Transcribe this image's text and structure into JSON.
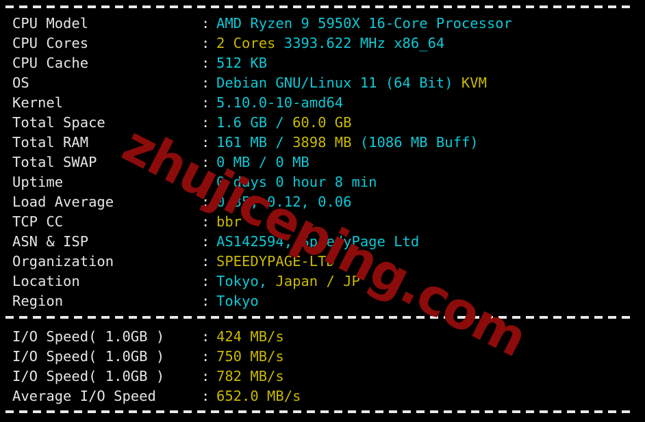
{
  "terminal": {
    "background_color": "#000000",
    "label_color": "#e6e6e6",
    "cyan_color": "#0fc7d4",
    "yellow_color": "#c9b900",
    "separator_char": "-",
    "colon": ":"
  },
  "watermark": {
    "text": "zhujiceping.com",
    "color": "#8c0b0b"
  },
  "system_info": {
    "rows": [
      {
        "label": "CPU Model",
        "segments": [
          {
            "text": "AMD Ryzen 9 5950X 16-Core Processor",
            "color": "cyan"
          }
        ]
      },
      {
        "label": "CPU Cores",
        "segments": [
          {
            "text": "2 Cores ",
            "color": "yellow"
          },
          {
            "text": "3393.622 MHz x86_64",
            "color": "cyan"
          }
        ]
      },
      {
        "label": "CPU Cache",
        "segments": [
          {
            "text": "512 KB",
            "color": "cyan"
          }
        ]
      },
      {
        "label": "OS",
        "segments": [
          {
            "text": "Debian GNU/Linux 11 (64 Bit) ",
            "color": "cyan"
          },
          {
            "text": "KVM",
            "color": "yellow"
          }
        ]
      },
      {
        "label": "Kernel",
        "segments": [
          {
            "text": "5.10.0-10-amd64",
            "color": "cyan"
          }
        ]
      },
      {
        "label": "Total Space",
        "segments": [
          {
            "text": "1.6 GB ",
            "color": "cyan"
          },
          {
            "text": "/ ",
            "color": "cyan"
          },
          {
            "text": "60.0 GB",
            "color": "yellow"
          }
        ]
      },
      {
        "label": "Total RAM",
        "segments": [
          {
            "text": "161 MB / ",
            "color": "cyan"
          },
          {
            "text": "3898 MB ",
            "color": "yellow"
          },
          {
            "text": "(1086 MB Buff)",
            "color": "cyan"
          }
        ]
      },
      {
        "label": "Total SWAP",
        "segments": [
          {
            "text": "0 MB / 0 MB",
            "color": "cyan"
          }
        ]
      },
      {
        "label": "Uptime",
        "segments": [
          {
            "text": "0 days 0 hour 8 min",
            "color": "cyan"
          }
        ]
      },
      {
        "label": "Load Average",
        "segments": [
          {
            "text": "0.35, 0.12, 0.06",
            "color": "cyan"
          }
        ]
      },
      {
        "label": "TCP CC",
        "segments": [
          {
            "text": "bbr",
            "color": "yellow"
          }
        ]
      },
      {
        "label": "ASN & ISP",
        "segments": [
          {
            "text": "AS142594, SpeedyPage Ltd",
            "color": "cyan"
          }
        ]
      },
      {
        "label": "Organization",
        "segments": [
          {
            "text": "SPEEDYPAGE-LTD",
            "color": "yellow"
          }
        ]
      },
      {
        "label": "Location",
        "segments": [
          {
            "text": "Tokyo, ",
            "color": "cyan"
          },
          {
            "text": "Japan / JP",
            "color": "yellow"
          }
        ]
      },
      {
        "label": "Region",
        "segments": [
          {
            "text": "Tokyo",
            "color": "cyan"
          }
        ]
      }
    ]
  },
  "io_benchmark": {
    "rows": [
      {
        "label": "I/O Speed( 1.0GB )",
        "segments": [
          {
            "text": "424 MB/s",
            "color": "yellow"
          }
        ]
      },
      {
        "label": "I/O Speed( 1.0GB )",
        "segments": [
          {
            "text": "750 MB/s",
            "color": "yellow"
          }
        ]
      },
      {
        "label": "I/O Speed( 1.0GB )",
        "segments": [
          {
            "text": "782 MB/s",
            "color": "yellow"
          }
        ]
      },
      {
        "label": "Average I/O Speed",
        "segments": [
          {
            "text": "652.0 MB/s",
            "color": "yellow"
          }
        ]
      }
    ]
  }
}
